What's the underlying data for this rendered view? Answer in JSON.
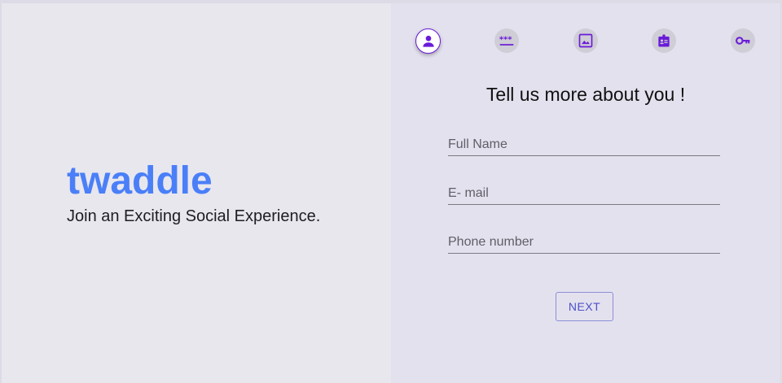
{
  "brand": {
    "title": "twaddle",
    "tagline": "Join an Exciting Social Experience."
  },
  "steps": [
    {
      "icon": "person-icon",
      "active": true
    },
    {
      "icon": "password-icon",
      "active": false
    },
    {
      "icon": "image-icon",
      "active": false
    },
    {
      "icon": "badge-icon",
      "active": false
    },
    {
      "icon": "key-icon",
      "active": false
    }
  ],
  "colors": {
    "brand": "#4a7ff8",
    "accent": "#6a1bd8",
    "button": "#4c50c9"
  },
  "form": {
    "heading": "Tell us more about you !",
    "full_name_placeholder": "Full Name",
    "email_placeholder": "E- mail",
    "phone_placeholder": "Phone number",
    "next_label": "NEXT"
  }
}
